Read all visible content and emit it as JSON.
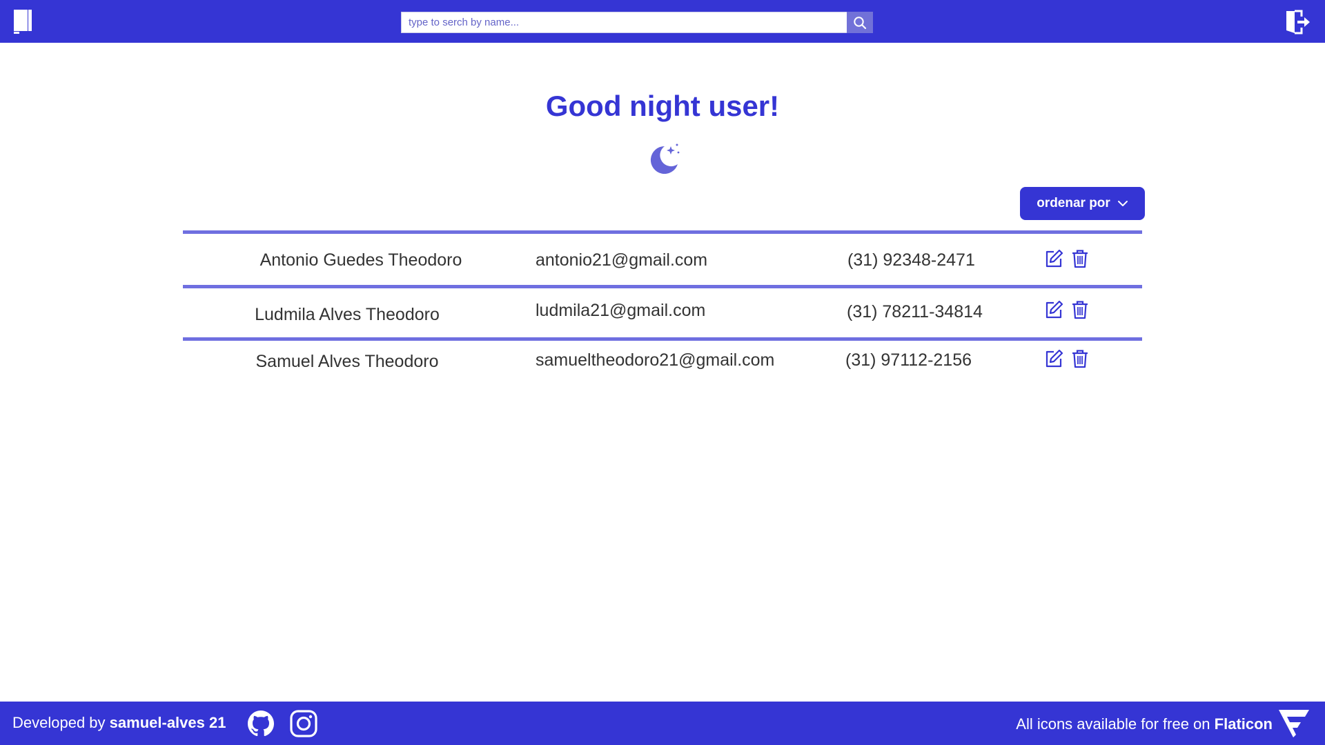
{
  "header": {
    "logo_icon": "notebook-icon",
    "search": {
      "placeholder": "type to serch by name...",
      "value": "",
      "button_icon": "search-icon"
    },
    "logout_icon": "logout-icon"
  },
  "greeting": {
    "text": "Good night user!",
    "icon": "moon-stars-icon"
  },
  "sort": {
    "label": "ordenar por",
    "icon": "chevron-down-icon"
  },
  "contacts": [
    {
      "name": "Antonio Guedes Theodoro",
      "email": "antonio21@gmail.com",
      "phone": "(31) 92348-2471"
    },
    {
      "name": "Ludmila Alves Theodoro",
      "email": "ludmila21@gmail.com",
      "phone": "(31) 78211-34814"
    },
    {
      "name": "Samuel Alves Theodoro",
      "email": "samueltheodoro21@gmail.com",
      "phone": "(31) 97112-2156"
    }
  ],
  "row_actions": {
    "edit_icon": "edit-icon",
    "delete_icon": "trash-icon"
  },
  "footer": {
    "dev_prefix": "Developed by",
    "dev_name": "samuel-alves 21",
    "github_icon": "github-icon",
    "instagram_icon": "instagram-icon",
    "credit_prefix": "All icons available for free on",
    "credit_brand": "Flaticon",
    "flaticon_icon": "flaticon-logo-icon"
  },
  "colors": {
    "primary": "#3535d4",
    "accent": "#6f6fe0",
    "text": "#333333",
    "background": "#ffffff"
  }
}
